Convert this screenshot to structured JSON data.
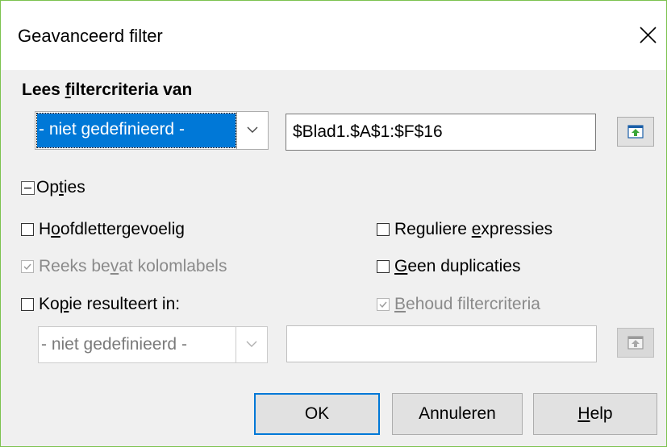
{
  "window": {
    "title": "Geavanceerd filter"
  },
  "criteria": {
    "heading_before": "Lees ",
    "heading_mnemonic": "f",
    "heading_after": "iltercriteria van",
    "range_select": "- niet gedefinieerd -",
    "range_value": "$Blad1.$A$1:$F$16"
  },
  "options": {
    "label_before": "Op",
    "label_mnemonic": "t",
    "label_after": "ies",
    "case_sensitive": {
      "pre": "H",
      "mn": "o",
      "post": "ofdlettergevoelig",
      "checked": false,
      "enabled": true
    },
    "regex": {
      "pre": "Reguliere ",
      "mn": "e",
      "post": "xpressies",
      "checked": false,
      "enabled": true
    },
    "contains_labels": {
      "pre": "Reeks be",
      "mn": "v",
      "post": "at kolomlabels",
      "checked": true,
      "enabled": false
    },
    "no_duplicates": {
      "pre": "",
      "mn": "G",
      "post": "een duplicaties",
      "checked": false,
      "enabled": true
    },
    "copy_results": {
      "pre": "Ko",
      "mn": "p",
      "post": "ie resulteert in:",
      "checked": false,
      "enabled": true
    },
    "keep_criteria": {
      "pre": "",
      "mn": "B",
      "post": "ehoud filtercriteria",
      "checked": true,
      "enabled": false
    },
    "copy_select": "- niet gedefinieerd -",
    "copy_value": ""
  },
  "buttons": {
    "ok": "OK",
    "cancel": "Annuleren",
    "help_mnemonic": "H",
    "help_rest": "elp"
  },
  "colors": {
    "accent": "#0078d7",
    "window_border": "#7cc24f",
    "dialog_bg": "#f0f0f0"
  },
  "icons": {
    "close": "close-icon",
    "collapse": "collapse-minus-icon",
    "shrink": "shrink-dialog-icon",
    "dropdown": "chevron-down-icon"
  }
}
